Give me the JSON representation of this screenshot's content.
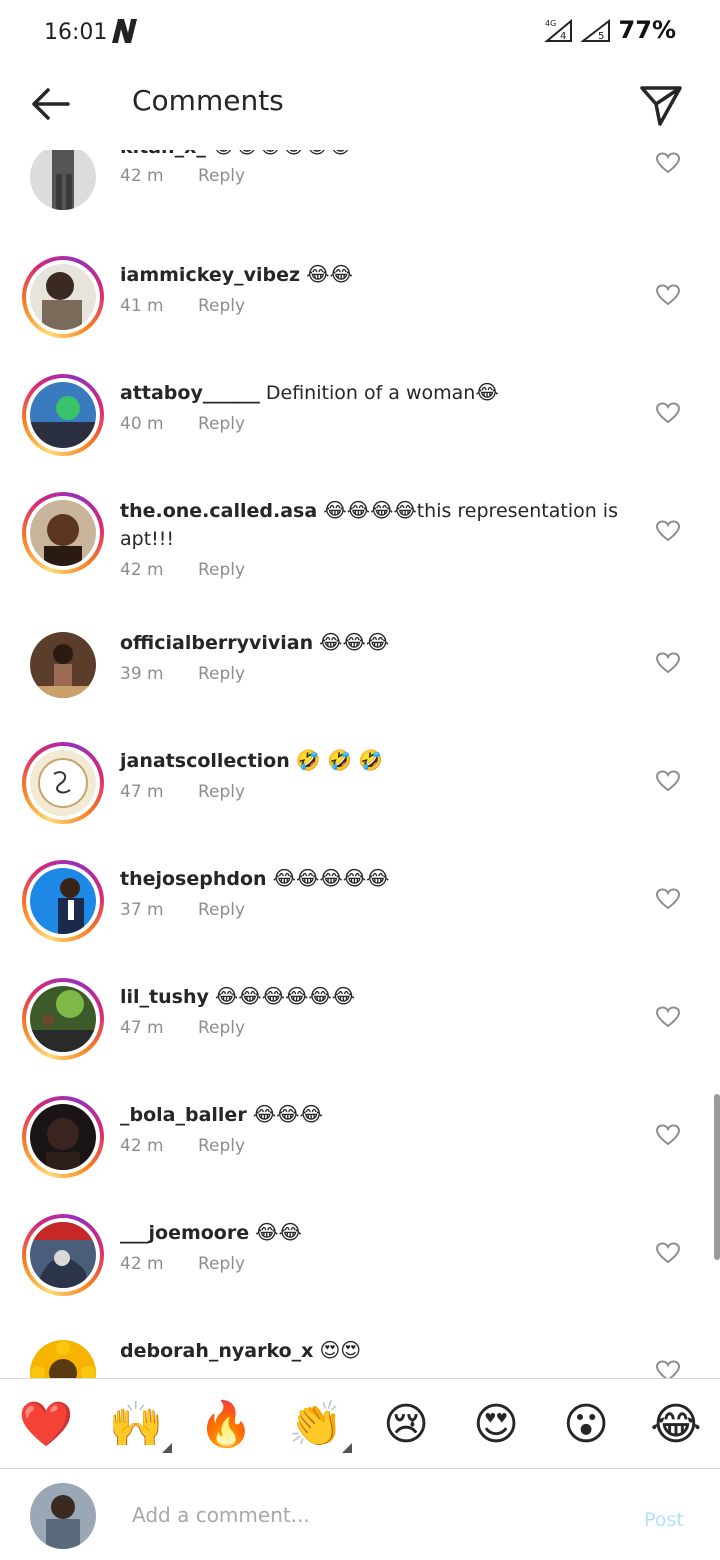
{
  "status_bar": {
    "time": "16:01",
    "carrier_logo": "N",
    "network": "4G",
    "battery": "77%"
  },
  "header": {
    "title": "Comments"
  },
  "comments": [
    {
      "user": "kitan_x_",
      "text": "",
      "emoji": "😂😂😂😂😂😂",
      "time": "42 m",
      "reply": "Reply"
    },
    {
      "user": "iammickey_vibez",
      "text": "",
      "emoji": "😂😂",
      "time": "41 m",
      "reply": "Reply"
    },
    {
      "user": "attaboy______",
      "text": " Definition of a woman",
      "emoji": "😂",
      "time": "40 m",
      "reply": "Reply"
    },
    {
      "user": "the.one.called.asa",
      "text": "this representation is apt!!!",
      "emoji": "😂😂😂😂",
      "time": "42 m",
      "reply": "Reply"
    },
    {
      "user": "officialberryvivian",
      "text": "",
      "emoji": "😂😂😂",
      "time": "39 m",
      "reply": "Reply"
    },
    {
      "user": "janatscollection",
      "text": "",
      "emoji": "🤣 🤣 🤣",
      "time": "47 m",
      "reply": "Reply"
    },
    {
      "user": "thejosephdon",
      "text": "",
      "emoji": "😂😂😂😂😂",
      "time": "37 m",
      "reply": "Reply"
    },
    {
      "user": "lil_tushy",
      "text": "",
      "emoji": "😂😂😂😂😂😂",
      "time": "47 m",
      "reply": "Reply"
    },
    {
      "user": "_bola_baller",
      "text": "",
      "emoji": "😂😂😂",
      "time": "42 m",
      "reply": "Reply"
    },
    {
      "user": "___joemoore",
      "text": "",
      "emoji": "😂😂",
      "time": "42 m",
      "reply": "Reply"
    },
    {
      "user": "deborah_nyarko_x",
      "text": "",
      "emoji": "😍😍",
      "time": "",
      "reply": ""
    }
  ],
  "emoji_bar": [
    "❤️",
    "🙌",
    "🔥",
    "👏",
    "😢",
    "😍",
    "😮",
    "😂"
  ],
  "composer": {
    "placeholder": "Add a comment...",
    "post_label": "Post"
  },
  "colors": {
    "post_disabled": "#b2dffc",
    "meta_gray": "#8e8e8e",
    "story_ring": "#d62976"
  },
  "icons": {
    "back": "arrow-left-icon",
    "share": "paper-plane-icon",
    "like": "heart-outline-icon"
  }
}
